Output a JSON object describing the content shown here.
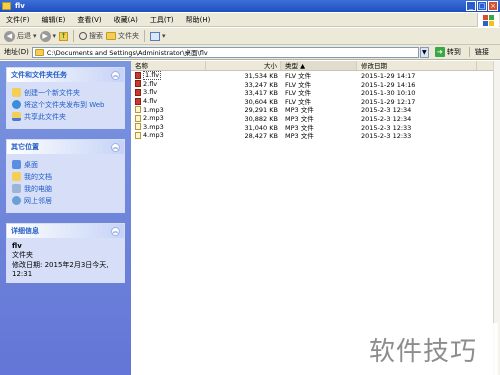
{
  "window": {
    "title": "flv"
  },
  "menu": [
    "文件(F)",
    "编辑(E)",
    "查看(V)",
    "收藏(A)",
    "工具(T)",
    "帮助(H)"
  ],
  "toolbar": {
    "back": "后退",
    "search": "搜索",
    "folders": "文件夹"
  },
  "address": {
    "label": "地址(D)",
    "value": "C:\\Documents and Settings\\Administrator\\桌面\\flv",
    "go": "转到",
    "links": "链接"
  },
  "tasks": {
    "title": "文件和文件夹任务",
    "items": [
      "创建一个新文件夹",
      "将这个文件夹发布到 Web",
      "共享此文件夹"
    ]
  },
  "places": {
    "title": "其它位置",
    "items": [
      "桌面",
      "我的文档",
      "我的电脑",
      "网上邻居"
    ]
  },
  "details": {
    "title": "详细信息",
    "name": "flv",
    "type": "文件夹",
    "modified": "修改日期: 2015年2月3日今天, 12:31"
  },
  "columns": {
    "name": "名称",
    "size": "大小",
    "type": "类型",
    "date": "修改日期"
  },
  "files": [
    {
      "name": "1.flv",
      "size": "31,534 KB",
      "type": "FLV 文件",
      "date": "2015-1-29 14:17",
      "icon": "flv-icon"
    },
    {
      "name": "2.flv",
      "size": "33,247 KB",
      "type": "FLV 文件",
      "date": "2015-1-29 14:16",
      "icon": "flv-icon"
    },
    {
      "name": "3.flv",
      "size": "33,417 KB",
      "type": "FLV 文件",
      "date": "2015-1-30 10:10",
      "icon": "flv-icon"
    },
    {
      "name": "4.flv",
      "size": "30,604 KB",
      "type": "FLV 文件",
      "date": "2015-1-29 12:17",
      "icon": "flv-icon"
    },
    {
      "name": "1.mp3",
      "size": "29,291 KB",
      "type": "MP3 文件",
      "date": "2015-2-3 12:34",
      "icon": "mp3-icon"
    },
    {
      "name": "2.mp3",
      "size": "30,882 KB",
      "type": "MP3 文件",
      "date": "2015-2-3 12:34",
      "icon": "mp3-icon"
    },
    {
      "name": "3.mp3",
      "size": "31,040 KB",
      "type": "MP3 文件",
      "date": "2015-2-3 12:33",
      "icon": "mp3-icon"
    },
    {
      "name": "4.mp3",
      "size": "28,427 KB",
      "type": "MP3 文件",
      "date": "2015-2-3 12:33",
      "icon": "mp3-icon"
    }
  ],
  "watermark": "软件技巧"
}
